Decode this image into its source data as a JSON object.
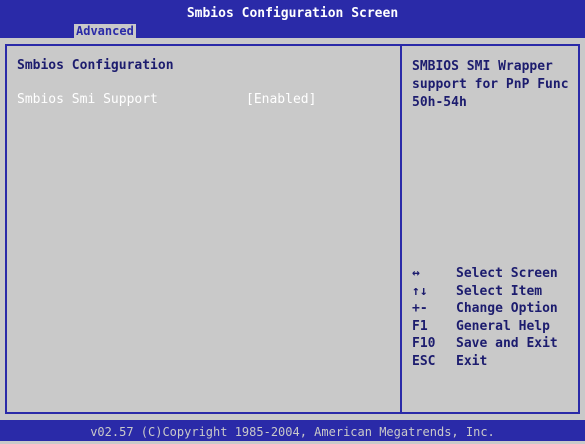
{
  "window": {
    "title": "Smbios Configuration Screen",
    "active_tab": "Advanced"
  },
  "main": {
    "section_title": "Smbios Configuration",
    "settings": [
      {
        "label": "Smbios Smi Support",
        "value": "[Enabled]"
      }
    ]
  },
  "help": {
    "lines": [
      "SMBIOS SMI Wrapper",
      "support for PnP Func",
      "50h-54h"
    ]
  },
  "keys": [
    {
      "key": "↔",
      "desc": "Select Screen"
    },
    {
      "key": "↑↓",
      "desc": "Select Item"
    },
    {
      "key": "+-",
      "desc": "Change Option"
    },
    {
      "key": "F1",
      "desc": "General Help"
    },
    {
      "key": "F10",
      "desc": "Save and Exit"
    },
    {
      "key": "ESC",
      "desc": "Exit"
    }
  ],
  "footer": {
    "text": "v02.57 (C)Copyright 1985-2004, American Megatrends, Inc."
  },
  "colors": {
    "bios_blue": "#2a2aa8",
    "bios_gray": "#c9c9c9",
    "text_dark": "#1c1c6e",
    "highlight_text": "#ffffff"
  }
}
